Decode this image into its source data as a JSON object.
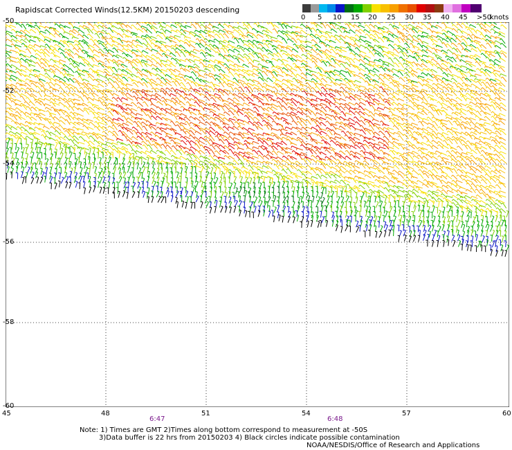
{
  "title": "Rapidscat Corrected Winds(12.5KM) 20150203 descending",
  "legend": {
    "labels": [
      "0",
      "5",
      "10",
      "15",
      "20",
      "25",
      "30",
      "35",
      "40",
      "45",
      ">50"
    ],
    "units": "knots",
    "colors": [
      "#3c3c3c",
      "#9a9a9a",
      "#00b8f0",
      "#0a14c8",
      "#00a800",
      "#80d000",
      "#f8e000",
      "#f8a000",
      "#e85000",
      "#d00000",
      "#8a3a10",
      "#e090e0",
      "#c000c0",
      "#500070"
    ]
  },
  "axes": {
    "x_ticks": [
      "45",
      "48",
      "51",
      "54",
      "57",
      "60"
    ],
    "y_ticks": [
      "-50",
      "-52",
      "-54",
      "-56",
      "-58",
      "-60"
    ]
  },
  "times": [
    "6:47",
    "6:48"
  ],
  "notes": {
    "line1": "Note: 1) Times are GMT 2)Times along bottom correspond to measurement at -50S",
    "line2": "3)Data buffer is 22 hrs from 20150203 4) Black circles indicate possible contamination",
    "credit": "NOAA/NESDIS/Office of Research and Applications"
  }
}
